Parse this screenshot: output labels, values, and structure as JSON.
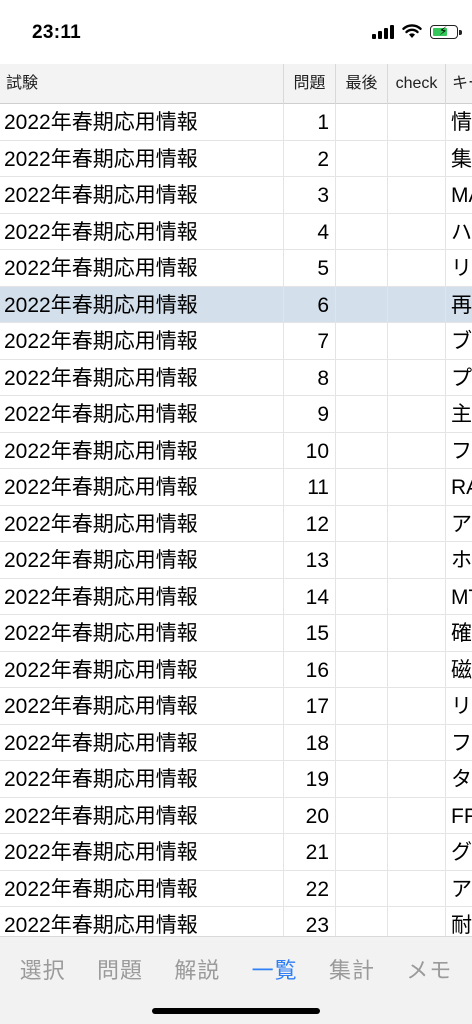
{
  "status_bar": {
    "time": "23:11"
  },
  "table": {
    "headers": {
      "exam": "試験",
      "question": "問題",
      "last": "最後",
      "check": "check",
      "keyword": "キー"
    },
    "rows": [
      {
        "exam": "2022年春期応用情報",
        "question": "1",
        "last": "",
        "check": "",
        "keyword": "情"
      },
      {
        "exam": "2022年春期応用情報",
        "question": "2",
        "last": "",
        "check": "",
        "keyword": "集"
      },
      {
        "exam": "2022年春期応用情報",
        "question": "3",
        "last": "",
        "check": "",
        "keyword": "MA"
      },
      {
        "exam": "2022年春期応用情報",
        "question": "4",
        "last": "",
        "check": "",
        "keyword": "ハ"
      },
      {
        "exam": "2022年春期応用情報",
        "question": "5",
        "last": "",
        "check": "",
        "keyword": "リ"
      },
      {
        "exam": "2022年春期応用情報",
        "question": "6",
        "last": "",
        "check": "",
        "keyword": "再",
        "selected": true
      },
      {
        "exam": "2022年春期応用情報",
        "question": "7",
        "last": "",
        "check": "",
        "keyword": "ブ"
      },
      {
        "exam": "2022年春期応用情報",
        "question": "8",
        "last": "",
        "check": "",
        "keyword": "プ"
      },
      {
        "exam": "2022年春期応用情報",
        "question": "9",
        "last": "",
        "check": "",
        "keyword": "主"
      },
      {
        "exam": "2022年春期応用情報",
        "question": "10",
        "last": "",
        "check": "",
        "keyword": "フ"
      },
      {
        "exam": "2022年春期応用情報",
        "question": "11",
        "last": "",
        "check": "",
        "keyword": "RA"
      },
      {
        "exam": "2022年春期応用情報",
        "question": "12",
        "last": "",
        "check": "",
        "keyword": "ア"
      },
      {
        "exam": "2022年春期応用情報",
        "question": "13",
        "last": "",
        "check": "",
        "keyword": "ホ"
      },
      {
        "exam": "2022年春期応用情報",
        "question": "14",
        "last": "",
        "check": "",
        "keyword": "MT"
      },
      {
        "exam": "2022年春期応用情報",
        "question": "15",
        "last": "",
        "check": "",
        "keyword": "確"
      },
      {
        "exam": "2022年春期応用情報",
        "question": "16",
        "last": "",
        "check": "",
        "keyword": "磁"
      },
      {
        "exam": "2022年春期応用情報",
        "question": "17",
        "last": "",
        "check": "",
        "keyword": "リ"
      },
      {
        "exam": "2022年春期応用情報",
        "question": "18",
        "last": "",
        "check": "",
        "keyword": "フ"
      },
      {
        "exam": "2022年春期応用情報",
        "question": "19",
        "last": "",
        "check": "",
        "keyword": "タ"
      },
      {
        "exam": "2022年春期応用情報",
        "question": "20",
        "last": "",
        "check": "",
        "keyword": "FF"
      },
      {
        "exam": "2022年春期応用情報",
        "question": "21",
        "last": "",
        "check": "",
        "keyword": "グ"
      },
      {
        "exam": "2022年春期応用情報",
        "question": "22",
        "last": "",
        "check": "",
        "keyword": "ア"
      },
      {
        "exam": "2022年春期応用情報",
        "question": "23",
        "last": "",
        "check": "",
        "keyword": "耐"
      }
    ]
  },
  "tab_bar": {
    "tabs": [
      {
        "label": "選択",
        "active": false
      },
      {
        "label": "問題",
        "active": false
      },
      {
        "label": "解説",
        "active": false
      },
      {
        "label": "一覧",
        "active": true
      },
      {
        "label": "集計",
        "active": false
      },
      {
        "label": "メモ",
        "active": false
      }
    ]
  },
  "colors": {
    "accent": "#2f7ff5",
    "selected_row": "#d3e0ec",
    "battery": "#34c759"
  }
}
